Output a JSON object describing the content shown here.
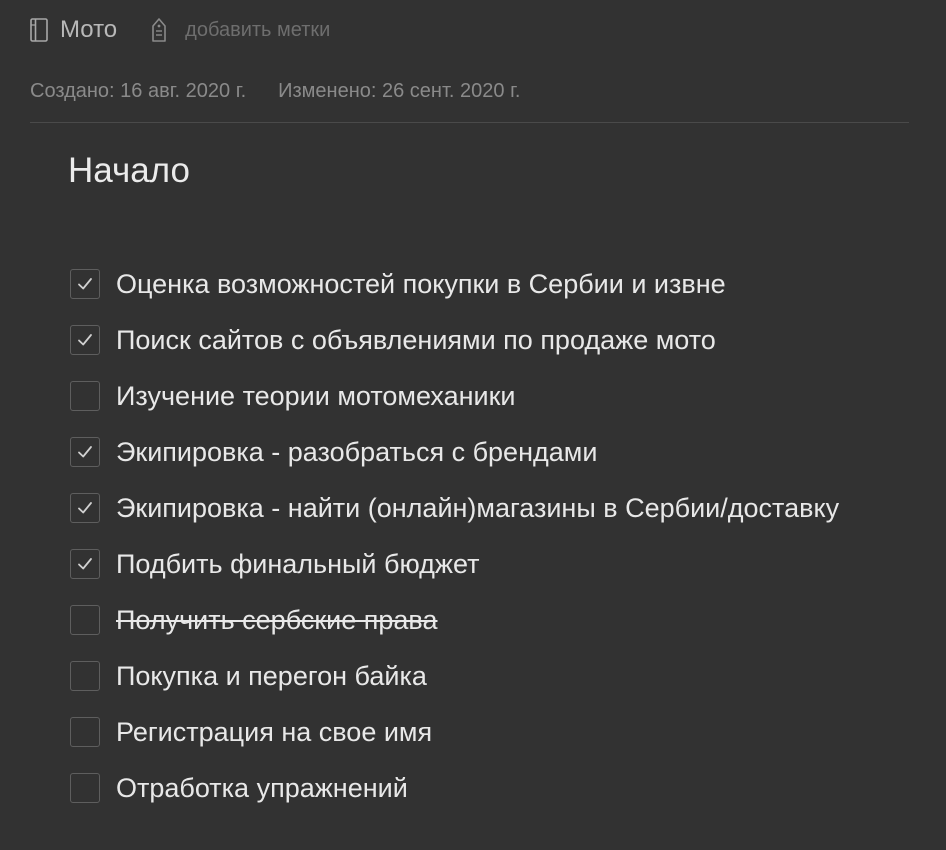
{
  "header": {
    "notebook_icon": "notebook-icon",
    "notebook_name": "Мото",
    "tag_icon": "tag-icon",
    "add_tags_label": "добавить метки"
  },
  "meta": {
    "created": "Создано: 16 авг. 2020 г.",
    "modified": "Изменено: 26 сент. 2020 г."
  },
  "note": {
    "title": "Начало",
    "checklist": [
      {
        "text": "Оценка возможностей покупки в Сербии и извне",
        "checked": true,
        "strikethrough": false
      },
      {
        "text": "Поиск сайтов с объявлениями по продаже мото",
        "checked": true,
        "strikethrough": false
      },
      {
        "text": "Изучение теории мотомеханики",
        "checked": false,
        "strikethrough": false
      },
      {
        "text": "Экипировка - разобраться с брендами",
        "checked": true,
        "strikethrough": false
      },
      {
        "text": "Экипировка - найти (онлайн)магазины в Сербии/доставку",
        "checked": true,
        "strikethrough": false
      },
      {
        "text": "Подбить финальный бюджет",
        "checked": true,
        "strikethrough": false
      },
      {
        "text": "Получить сербские права",
        "checked": false,
        "strikethrough": true
      },
      {
        "text": "Покупка и перегон байка",
        "checked": false,
        "strikethrough": false
      },
      {
        "text": "Регистрация на свое имя",
        "checked": false,
        "strikethrough": false
      },
      {
        "text": "Отработка упражнений",
        "checked": false,
        "strikethrough": false
      }
    ]
  },
  "colors": {
    "background": "#323232",
    "text": "#e8e8e8",
    "muted": "#8a8a8a",
    "checkbox_border": "#5e5e5e"
  }
}
